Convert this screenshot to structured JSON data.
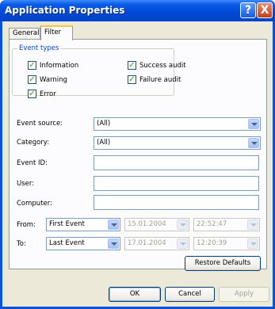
{
  "window": {
    "title": "Application Properties"
  },
  "titlebar_buttons": {
    "help": "?",
    "close": "X"
  },
  "tabs": [
    {
      "label": "General"
    },
    {
      "label": "Filter"
    }
  ],
  "event_types": {
    "label": "Event types",
    "checkboxes": [
      {
        "label": "Information",
        "checked": true
      },
      {
        "label": "Success audit",
        "checked": true
      },
      {
        "label": "Warning",
        "checked": true
      },
      {
        "label": "Failure audit",
        "checked": true
      },
      {
        "label": "Error",
        "checked": true
      }
    ]
  },
  "fields": {
    "event_source": {
      "label": "Event source:",
      "value": "(All)"
    },
    "category": {
      "label": "Category:",
      "value": "(All)"
    },
    "event_id": {
      "label": "Event ID:",
      "value": ""
    },
    "user": {
      "label": "User:",
      "value": ""
    },
    "computer": {
      "label": "Computer:",
      "value": ""
    }
  },
  "range": {
    "from": {
      "label": "From:",
      "mode": "First Event",
      "date": "15.01.2004",
      "time": "22:52:47"
    },
    "to": {
      "label": "To:",
      "mode": "Last Event",
      "date": "17.01.2004",
      "time": "12:20:39"
    }
  },
  "buttons": {
    "restore": "Restore Defaults",
    "ok": "OK",
    "cancel": "Cancel",
    "apply": "Apply"
  },
  "check_mark": "✓",
  "colors": {
    "title_bar": "#0a53d8",
    "client": "#ece9d8",
    "group_label": "#0046d5",
    "check": "#21a121"
  }
}
